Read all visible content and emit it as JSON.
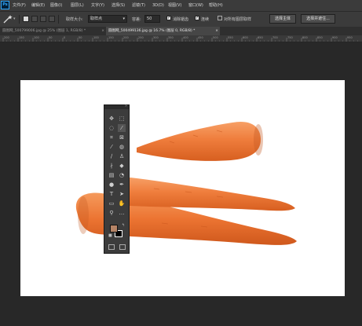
{
  "app": {
    "logo": "Ps"
  },
  "menu": [
    "文件(F)",
    "编辑(E)",
    "图像(I)",
    "图层(L)",
    "文字(Y)",
    "选择(S)",
    "滤镜(T)",
    "3D(D)",
    "视图(V)",
    "窗口(W)",
    "帮助(H)"
  ],
  "options": {
    "sample_size_label": "取样大小:",
    "sample_size_value": "取样点",
    "tolerance_label": "容差:",
    "tolerance_value": "50",
    "anti_alias_label": "消除锯齿",
    "contiguous_label": "连续",
    "sample_all_layers_label": "对所有图层取样",
    "select_subject_button": "选择主体",
    "select_and_mask_button": "选择并遮住..."
  },
  "tabs": [
    {
      "label": "圆图网_500799006.jpg @ 25% (图层 1, RGB/8) *",
      "active": false
    },
    {
      "label": "圆图网_500499136.jpg @ 16.7% (图层 0, RGB/8) *",
      "active": true
    }
  ],
  "ruler_ticks": [
    "200",
    "150",
    "100",
    "50",
    "0",
    "50",
    "100",
    "150",
    "200",
    "250",
    "300",
    "350",
    "400",
    "450",
    "500",
    "550",
    "600",
    "650",
    "700",
    "750",
    "800",
    "850",
    "900",
    "950"
  ],
  "colors": {
    "foreground": "#b58466",
    "background": "#000000",
    "accent": "#31a8ff",
    "canvas": "#ffffff",
    "carrot": "#ef7d3c"
  },
  "tools": [
    [
      "move-icon",
      "marquee-icon"
    ],
    [
      "lasso-icon",
      "magic-wand-icon"
    ],
    [
      "crop-icon",
      "frame-icon"
    ],
    [
      "eyedropper-icon",
      "spot-heal-icon"
    ],
    [
      "brush-icon",
      "stamp-icon"
    ],
    [
      "history-brush-icon",
      "eraser-icon"
    ],
    [
      "gradient-icon",
      "blur-icon"
    ],
    [
      "dodge-icon",
      "pen-icon"
    ],
    [
      "type-icon",
      "path-select-icon"
    ],
    [
      "rectangle-icon",
      "hand-icon"
    ],
    [
      "zoom-icon",
      "more-icon"
    ]
  ]
}
